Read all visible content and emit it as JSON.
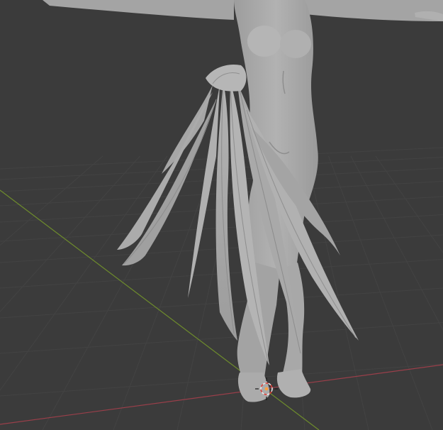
{
  "viewport": {
    "background": "#3b3b3b",
    "grid_color": "#434343",
    "x_axis_color": "#9a3f4a",
    "y_axis_color": "#6e8c2c",
    "model_color": "#a7a7a7",
    "model_shade": "#8a8a8a",
    "model_highlight": "#bdbdbd"
  },
  "cursor_3d": {
    "ring_color_a": "#e8e8e8",
    "ring_color_b": "#e0403a",
    "center_color": "#ffa040"
  }
}
